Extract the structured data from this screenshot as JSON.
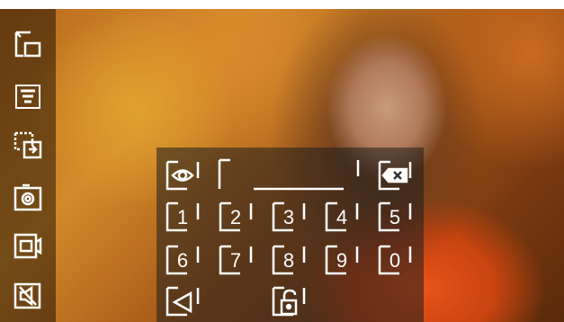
{
  "sidebar": {
    "items": [
      {
        "icon": "monitor-switch-icon"
      },
      {
        "icon": "menu-list-icon"
      },
      {
        "icon": "camera-switch-icon"
      },
      {
        "icon": "snapshot-camera-icon"
      },
      {
        "icon": "video-record-icon"
      },
      {
        "icon": "mute-icon"
      }
    ]
  },
  "keypad": {
    "password_value": "",
    "digits_row1": [
      "1",
      "2",
      "3",
      "4",
      "5"
    ],
    "digits_row2": [
      "6",
      "7",
      "8",
      "9",
      "0"
    ]
  },
  "colors": {
    "icon": "#ffffff",
    "panel": "rgba(30,30,30,0.55)"
  }
}
